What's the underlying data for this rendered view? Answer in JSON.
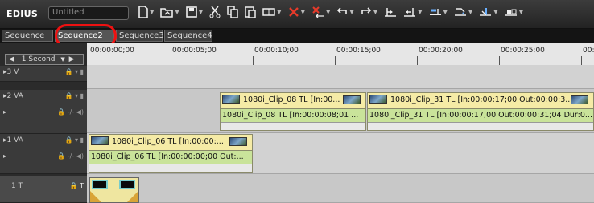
{
  "app": {
    "logo": "EDIUS",
    "project_name": "Untitled"
  },
  "toolbar": {
    "buttons": [
      {
        "icon": "new-sequence-icon",
        "has_dropdown": true
      },
      {
        "icon": "open-project-icon",
        "has_dropdown": true
      },
      {
        "icon": "save-icon",
        "has_dropdown": true
      },
      {
        "icon": "cut-icon",
        "has_dropdown": false
      },
      {
        "icon": "copy-icon",
        "has_dropdown": false
      },
      {
        "icon": "paste-icon",
        "has_dropdown": false
      },
      {
        "icon": "insert-mode-icon",
        "has_dropdown": true
      },
      {
        "icon": "delete-icon",
        "has_dropdown": true
      },
      {
        "icon": "ripple-delete-icon",
        "has_dropdown": true
      },
      {
        "icon": "undo-icon",
        "has_dropdown": true
      },
      {
        "icon": "redo-icon",
        "has_dropdown": true
      },
      {
        "icon": "set-in-icon",
        "has_dropdown": false
      },
      {
        "icon": "set-out-icon",
        "has_dropdown": true
      },
      {
        "icon": "add-cut-icon",
        "has_dropdown": true
      },
      {
        "icon": "link-icon",
        "has_dropdown": true
      },
      {
        "icon": "snap-icon",
        "has_dropdown": true
      },
      {
        "icon": "trim-icon",
        "has_dropdown": true
      }
    ]
  },
  "tabs": [
    {
      "label": "Sequence",
      "active": false
    },
    {
      "label": "Sequence2",
      "active": true
    },
    {
      "label": "Sequence3",
      "active": false
    },
    {
      "label": "Sequence4",
      "active": false
    }
  ],
  "timescale": {
    "label": "1 Second",
    "left_arrow": "◀",
    "right_arrow": "▶"
  },
  "ruler": {
    "timecodes": [
      "00:00:00;00",
      "00:00:05;00",
      "00:00:10;00",
      "00:00:15;00",
      "00:00:20;00",
      "00:00:25;00",
      "00:"
    ]
  },
  "tracks": [
    {
      "name": "3 V",
      "type": "video",
      "icons": "🔒 ▾ ▮",
      "icons2": ""
    },
    {
      "name": "2 VA",
      "type": "video-audio",
      "icons": "🔒 ▾ ▮",
      "icons2": "🔒 -/- ◀)"
    },
    {
      "name": "1 VA",
      "type": "video-audio",
      "icons": "🔒 ▾ ▮",
      "icons2": "🔒 -/- ◀)"
    },
    {
      "name": "1 T",
      "type": "title",
      "icons": "🔒 T",
      "icons2": ""
    }
  ],
  "clips": [
    {
      "track": "2 VA",
      "video_label": "1080i_Clip_08  TL [In:00...",
      "audio_label": "1080i_Clip_08  TL [In:00:00:08;01 ..."
    },
    {
      "track": "2 VA",
      "video_label": "1080i_Clip_31  TL [In:00:00:17;00 Out:00:00:3...",
      "audio_label": "1080i_Clip_31  TL [In:00:00:17;00 Out:00:00:31;04 Dur:0..."
    },
    {
      "track": "1 VA",
      "video_label": "1080i_Clip_06  TL [In:00:00:...",
      "audio_label": "1080i_Clip_06  TL [In:00:00:00;00 Out:..."
    }
  ],
  "colors": {
    "clip_video": "#f5eba6",
    "clip_audio": "#c9e39a",
    "highlight": "#e11111",
    "panel_dark": "#2b2b2b"
  }
}
